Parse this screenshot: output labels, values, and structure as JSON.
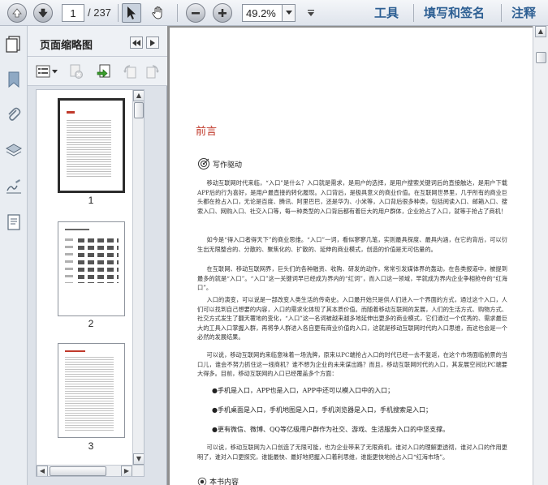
{
  "toolbar": {
    "page_current": "1",
    "page_total": "/ 237",
    "zoom": "49.2%",
    "tools_label": "工具",
    "sign_label": "填写和签名",
    "comment_label": "注释"
  },
  "panel": {
    "title": "页面缩略图",
    "thumbnails": [
      {
        "label": "1"
      },
      {
        "label": "2"
      },
      {
        "label": "3"
      }
    ]
  },
  "document": {
    "title": "前言",
    "section_heading": "写作驱动",
    "paragraphs": [
      "移动互联网时代来临，“入口”是什么？入口就是需求，是用户的选择，是用户搜索关键词后的直接触达，是用户下载APP后的行为喜好，是用户最直接的转化履现。入口背后，是极具意义的商业价值。在互联网世界里，几乎所有的商业巨头都在抢占入口，无论是百度、腾讯、阿里巴巴，还是华为、小米等，入口背后很多种类，包括阅读入口、邮箱入口、搜索入口、网购入口、社交入口等，每一种类型的入口背后都有着巨大的用户群体，企业抢占了入口，就等于抢占了商机！",
      "如今是“得入口者得天下”的商业思维。“入口”一词，看似寥寥几笔，实则最具探度、最具内涵，在它的背后，可以衍生出无限整合的、分散的、聚焦化的、扩散的、延伸的商业模式，创造的价值是无可估量的。",
      "在互联网、移动互联网界，巨头们的各种融资、收购、研发的动作，常常引发媒体界的轰动，在各类报道中，被提到最多的就是“入口”。“入口”这一关键词早已经成为界内的“红词”，而入口这一领域，早就成为界内企业争相抢夺的“红海口”。",
      "入口的演变，可以说是一部改变人类生活的传奇史。入口最开始只是供人们进入一个界面的方式，通过这个入口，人们可以找到自己想要的内容，入口的需求化体现了其本质价值。而随着移动互联网的发展，人们的生活方式、购物方式、社交方式发生了翻天覆地的变化，“入口”这一名词被越来越多地延伸出更多的商业模式，它们通过一个优秀的、需求最巨大的工具入口掌握入群，再将争人群进入各自更有商业价值的入口，这就是移动互联网时代的入口思维，而这也会是一个必然的发展结果。",
      "可以说，移动互联网的来临意味着一场洗牌，原来以PC端抢占入口的时代已经一去不复返，在这个市场面临前景的当口儿，谁会不努力抓住这一线商机？谁不想为企业的未来谋出路？而且，移动互联网时代的入口，其发展空间比PC端要大得多。目前，移动互联网的入口已经覆盖多个方面："
    ],
    "bullets": [
      "●手机是入口，APP也是入口，APP中还可以模入口中的入口；",
      "●手机桌面是入口，手机地图是入口，手机浏览器是入口，手机搜索是入口；",
      "●更有微信、微博、QQ等亿级用户群作为社交、游戏、生活服务入口的中坚支撑。"
    ],
    "closing": "可以说，移动互联网为入口创造了无限可能，也为企业带来了无限商机，谁对入口的理解更透彻，谁对入口的作用更明了，谁对入口更探究，谁能最快、最好地把握入口着利思维，谁能更快地抢占入口“红海市场”。",
    "next_heading": "本书内容"
  },
  "colors": {
    "accent_red": "#c0392b",
    "toolbar_link": "#2d5f93"
  }
}
